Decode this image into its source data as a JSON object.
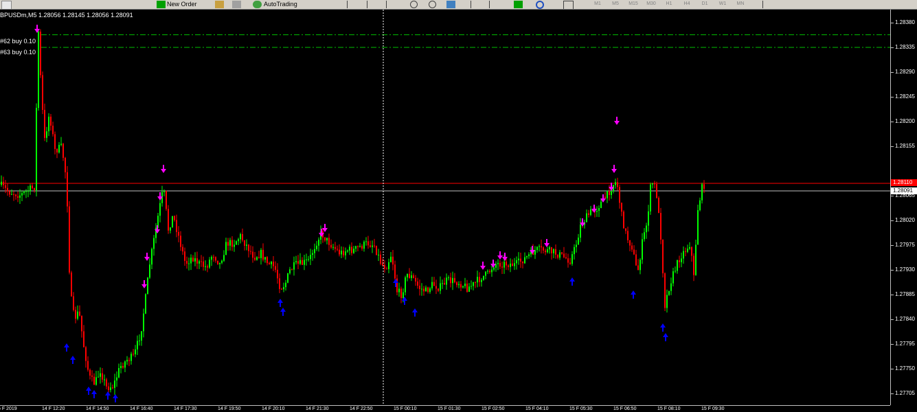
{
  "toolbar": {
    "new_order_label": "New Order",
    "autotrading_label": "AutoTrading",
    "timeframes": [
      "M1",
      "M5",
      "M15",
      "M30",
      "H1",
      "H4",
      "D1",
      "W1",
      "MN"
    ]
  },
  "chart": {
    "symbol_info": "BPUSDm,M5  1.28056 1.28145 1.28056 1.28091",
    "orders": [
      {
        "label": "#62 buy 0.10",
        "price": 1.28358
      },
      {
        "label": "#63 buy 0.10",
        "price": 1.28335
      }
    ],
    "current_price": "1.28091",
    "bid_line_label": "1.28110",
    "price_ticks": [
      {
        "label": "1.28380",
        "value": 1.2838
      },
      {
        "label": "1.28335",
        "value": 1.28335
      },
      {
        "label": "1.28290",
        "value": 1.2829
      },
      {
        "label": "1.28245",
        "value": 1.28245
      },
      {
        "label": "1.28200",
        "value": 1.282
      },
      {
        "label": "1.28155",
        "value": 1.28155
      },
      {
        "label": "1.28065",
        "value": 1.28065
      },
      {
        "label": "1.28020",
        "value": 1.2802
      },
      {
        "label": "1.27975",
        "value": 1.27975
      },
      {
        "label": "1.27930",
        "value": 1.2793
      },
      {
        "label": "1.27885",
        "value": 1.27885
      },
      {
        "label": "1.27840",
        "value": 1.2784
      },
      {
        "label": "1.27795",
        "value": 1.27795
      },
      {
        "label": "1.27750",
        "value": 1.2775
      },
      {
        "label": "1.27705",
        "value": 1.27705
      }
    ],
    "time_labels": [
      "5 F 2019",
      "14 F  12:20",
      "14 F  14:50",
      "14 F  16:40",
      "14 F  17:30",
      "14 F  19:50",
      "14 F  20:10",
      "14 F  21:30",
      "14 F  22:50",
      "15 F  00:10",
      "15 F  01:30",
      "15 F  02:50",
      "15 F  04:10",
      "15 F  05:30",
      "15 F  06:50",
      "15 F  08:10",
      "15 F  09:30"
    ],
    "colors": {
      "bull": "#00ff00",
      "bear": "#ff0000",
      "sell_arrow": "#ff00ff",
      "buy_arrow": "#0000ff",
      "order_line": "#00c000",
      "bid_line": "#ff0000",
      "price_line": "#c0c0c0"
    }
  }
}
